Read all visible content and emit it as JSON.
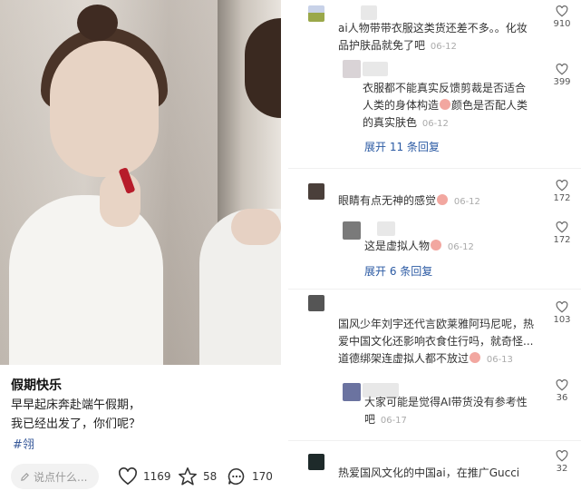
{
  "post": {
    "title": "假期快乐",
    "body_line1": "早早起床奔赴端午假期，",
    "body_line2": "我已经出发了，你们呢？",
    "hashtag": "#翎",
    "comment_placeholder": "说点什么...",
    "likes": "1169",
    "stars": "58",
    "comments": "170"
  },
  "comments": [
    {
      "text1": "ai人物带带衣服这类货还差不多。。化妆",
      "text2": "品护肤品就免了吧",
      "time": "06-12",
      "likes": "910",
      "avatar_color": "#9aa84a"
    },
    {
      "text1": "衣服都不能真实反馈剪裁是否适合",
      "text2": "人类的身体构造",
      "text2b": "颜色是否配人类",
      "text3": "的真实肤色",
      "time": "06-12",
      "likes": "399",
      "expand": "展开 11 条回复"
    },
    {
      "text1": "眼睛有点无神的感觉",
      "time": "06-12",
      "likes": "172",
      "avatar_color": "#4a3f3a"
    },
    {
      "text1": "这是虚拟人物",
      "time": "06-12",
      "likes": "172",
      "expand": "展开 6 条回复"
    },
    {
      "text1": "国风少年刘宇还代言欧莱雅阿玛尼呢，热",
      "text2": "爱中国文化还影响衣食住行吗，就奇怪...",
      "text3": "道德绑架连虚拟人都不放过",
      "time": "06-13",
      "likes": "103",
      "avatar_color": "#555555"
    },
    {
      "text1": "大家可能是觉得AI带货没有参考性",
      "text2": "吧",
      "time": "06-17",
      "likes": "36"
    },
    {
      "text1": "热爱国风文化的中国ai，在推广Gucci",
      "likes": "32",
      "avatar_color": "#1e2a2a"
    }
  ]
}
